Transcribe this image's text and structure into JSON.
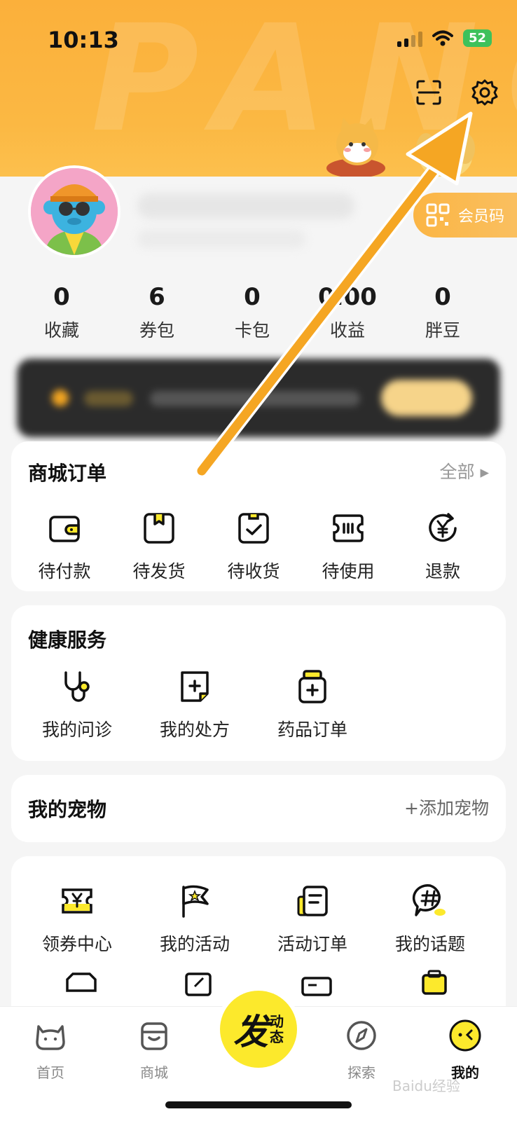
{
  "status_bar": {
    "time": "10:13",
    "battery": "52"
  },
  "header": {
    "bg_text": "PANG"
  },
  "profile": {
    "member_code_label": "会员码"
  },
  "stats": [
    {
      "value": "0",
      "label": "收藏"
    },
    {
      "value": "6",
      "label": "券包"
    },
    {
      "value": "0",
      "label": "卡包"
    },
    {
      "value": "0.00",
      "label": "收益"
    },
    {
      "value": "0",
      "label": "胖豆"
    }
  ],
  "mall_orders": {
    "title": "商城订单",
    "view_all": "全部 ▸",
    "items": [
      {
        "label": "待付款",
        "icon": "wallet-icon"
      },
      {
        "label": "待发货",
        "icon": "package-icon"
      },
      {
        "label": "待收货",
        "icon": "receive-check-icon"
      },
      {
        "label": "待使用",
        "icon": "ticket-icon"
      },
      {
        "label": "退款",
        "icon": "refund-yen-icon"
      }
    ]
  },
  "health": {
    "title": "健康服务",
    "items": [
      {
        "label": "我的问诊",
        "icon": "stethoscope-icon"
      },
      {
        "label": "我的处方",
        "icon": "prescription-icon"
      },
      {
        "label": "药品订单",
        "icon": "medicine-bottle-icon"
      }
    ]
  },
  "pets": {
    "title": "我的宠物",
    "add_label": "+添加宠物"
  },
  "services": {
    "items": [
      {
        "label": "领券中心",
        "icon": "coupon-yen-icon"
      },
      {
        "label": "我的活动",
        "icon": "flag-star-icon"
      },
      {
        "label": "活动订单",
        "icon": "activity-order-icon"
      },
      {
        "label": "我的话题",
        "icon": "topic-hashtag-icon"
      }
    ]
  },
  "nav": {
    "items": [
      {
        "label": "首页",
        "icon": "home-cat-icon"
      },
      {
        "label": "商城",
        "icon": "shop-icon"
      },
      {
        "label": "探索",
        "icon": "compass-icon"
      },
      {
        "label": "我的",
        "icon": "me-face-icon"
      }
    ],
    "post_big": "发",
    "post_small_1": "动",
    "post_small_2": "态"
  },
  "watermark": "Baidu经验",
  "colors": {
    "header": "#fbb03b",
    "accent_yellow": "#fce92c",
    "arrow": "#f5a623"
  }
}
